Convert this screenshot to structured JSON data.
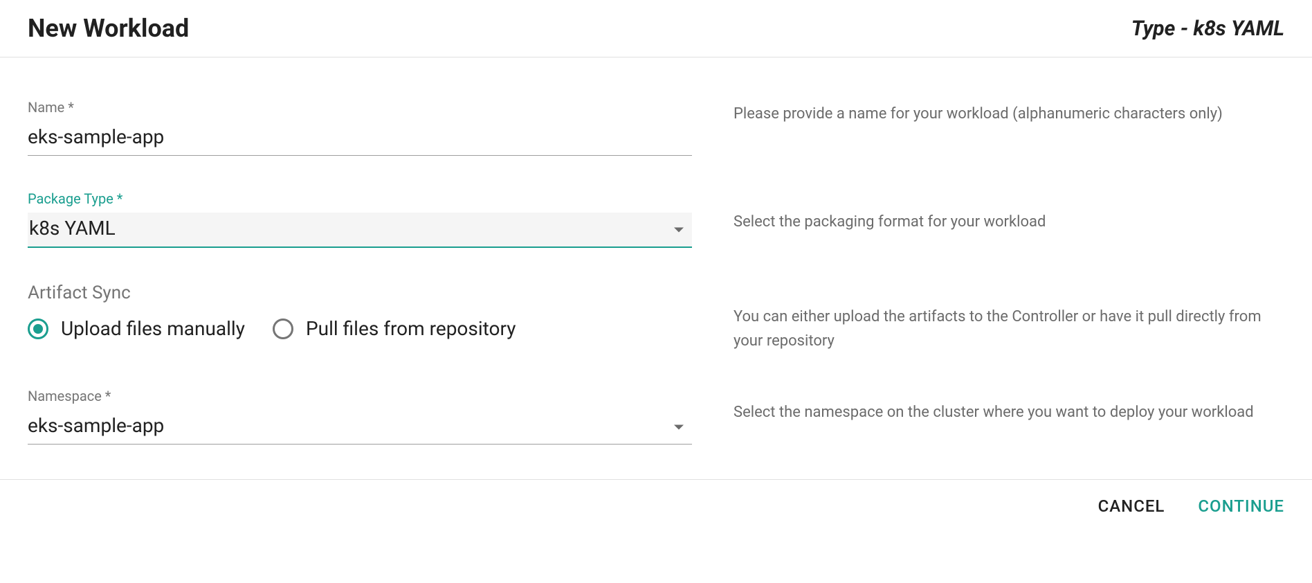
{
  "header": {
    "title": "New Workload",
    "type_label": "Type - k8s YAML"
  },
  "fields": {
    "name": {
      "label": "Name *",
      "value": "eks-sample-app",
      "helper": "Please provide a name for your workload (alphanumeric characters only)"
    },
    "package_type": {
      "label": "Package Type *",
      "value": "k8s YAML",
      "helper": "Select the packaging format for your workload"
    },
    "artifact_sync": {
      "heading": "Artifact Sync",
      "option_upload": "Upload files manually",
      "option_pull": "Pull files from repository",
      "selected": "upload",
      "helper": "You can either upload the artifacts to the Controller or have it pull directly from your repository"
    },
    "namespace": {
      "label": "Namespace *",
      "value": "eks-sample-app",
      "helper": "Select the namespace on the cluster where you want to deploy your workload"
    }
  },
  "footer": {
    "cancel_label": "CANCEL",
    "continue_label": "CONTINUE"
  }
}
